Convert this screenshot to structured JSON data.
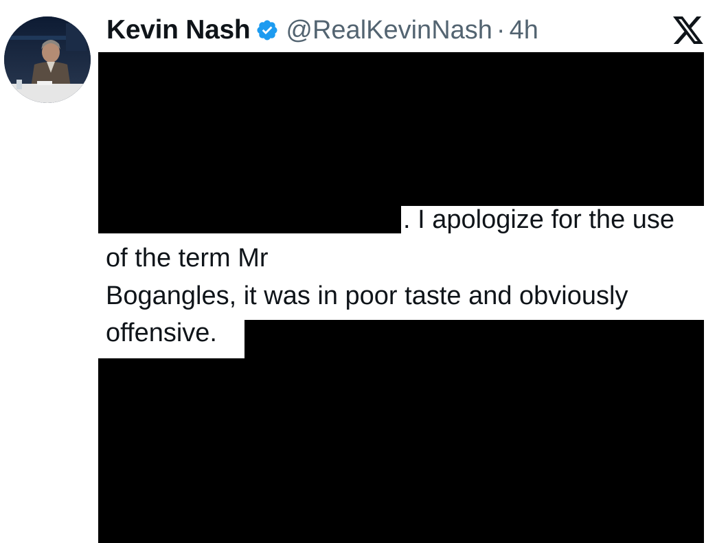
{
  "tweet": {
    "author": {
      "display_name": "Kevin Nash",
      "handle": "@RealKevinNash",
      "verified_icon": "verified-badge-icon",
      "avatar": "avatar"
    },
    "separator": "·",
    "timestamp": "4h",
    "platform_logo": "x-logo-icon",
    "body_lines": [
      ". I apologize for the use",
      "of the term Mr",
      " Bogangles, it was in poor taste and obviously",
      "offensive."
    ],
    "redacted": true
  },
  "colors": {
    "name": "#0f1419",
    "secondary": "#536471",
    "verified": "#1d9bf0",
    "redaction": "#000000"
  }
}
